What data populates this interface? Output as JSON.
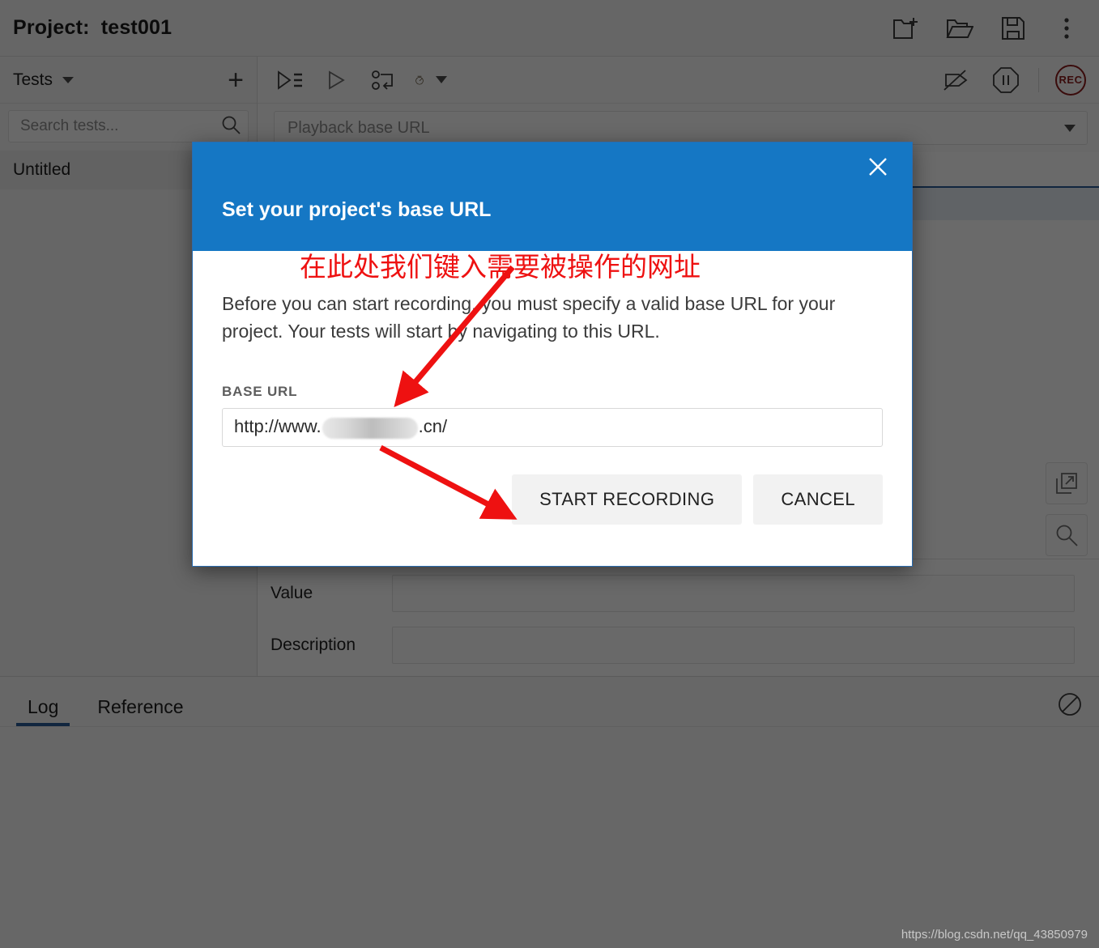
{
  "header": {
    "project_label": "Project:",
    "project_name": "test001",
    "actions": [
      {
        "name": "new-project-icon",
        "title": "New project"
      },
      {
        "name": "open-project-icon",
        "title": "Open project"
      },
      {
        "name": "save-project-icon",
        "title": "Save project"
      },
      {
        "name": "more-menu-icon",
        "title": "More options"
      }
    ]
  },
  "sidebar": {
    "section_label": "Tests",
    "add_label": "+",
    "search": {
      "placeholder": "Search tests...",
      "value": ""
    },
    "tests": [
      {
        "label": "Untitled",
        "selected": true
      }
    ]
  },
  "toolbar": {
    "left_icons": [
      {
        "name": "run-all-tests-icon",
        "title": "Run all tests"
      },
      {
        "name": "run-current-test-icon",
        "title": "Run current test"
      },
      {
        "name": "step-debug-icon",
        "title": "Step"
      },
      {
        "name": "speed-control-icon",
        "title": "Test execution speed"
      }
    ],
    "right_icons": [
      {
        "name": "disable-breakpoints-icon",
        "title": "Disable breakpoints"
      },
      {
        "name": "pause-icon",
        "title": "Pause test execution"
      },
      {
        "name": "record-button",
        "title": "Record",
        "label": "REC",
        "color": "#8b1c1c"
      }
    ]
  },
  "playback": {
    "placeholder": "Playback base URL",
    "value": "",
    "dropdown_icon": "chevron-down-icon"
  },
  "detail": {
    "fields": [
      {
        "label": "Value",
        "value": ""
      },
      {
        "label": "Description",
        "value": ""
      }
    ],
    "side_tools": [
      {
        "name": "open-in-new-window-icon",
        "title": "Open in new window"
      },
      {
        "name": "find-target-icon",
        "title": "Find target"
      }
    ]
  },
  "log_panel": {
    "tabs": [
      {
        "label": "Log",
        "active": true
      },
      {
        "label": "Reference",
        "active": false
      }
    ],
    "clear_icon": "clear-log-icon"
  },
  "dialog": {
    "title": "Set your project's base URL",
    "close_icon": "close-icon",
    "header_color": "#1577c4",
    "body_text": "Before you can start recording, you must specify a valid base URL for your project. Your tests will start by navigating to this URL.",
    "field_label": "BASE URL",
    "url_prefix": "http://www.",
    "url_suffix": ".cn/",
    "url_redacted": true,
    "buttons": [
      {
        "label": "START RECORDING",
        "name": "start-recording-button"
      },
      {
        "label": "CANCEL",
        "name": "cancel-button"
      }
    ]
  },
  "annotations": {
    "note_text": "在此处我们键入需要被操作的网址",
    "color": "#ee1111"
  },
  "watermark": {
    "text": "https://blog.csdn.net/qq_43850979"
  }
}
